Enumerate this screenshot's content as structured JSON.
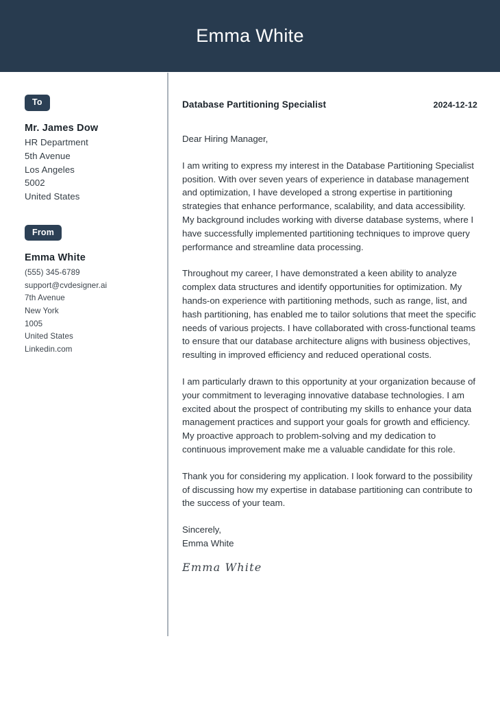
{
  "header": {
    "name": "Emma White"
  },
  "sidebar": {
    "to": {
      "badge_label": "To",
      "name": "Mr. James Dow",
      "lines": [
        "HR Department",
        "5th Avenue",
        "Los Angeles",
        "5002",
        "United States"
      ]
    },
    "from": {
      "badge_label": "From",
      "name": "Emma White",
      "lines": [
        "(555) 345-6789",
        "support@cvdesigner.ai",
        "7th Avenue",
        "New York",
        "1005",
        "United States",
        "Linkedin.com"
      ]
    }
  },
  "letter": {
    "job_title": "Database Partitioning Specialist",
    "date": "2024-12-12",
    "salutation": "Dear Hiring Manager,",
    "paragraphs": [
      "I am writing to express my interest in the Database Partitioning Specialist position. With over seven years of experience in database management and optimization, I have developed a strong expertise in partitioning strategies that enhance performance, scalability, and data accessibility. My background includes working with diverse database systems, where I have successfully implemented partitioning techniques to improve query performance and streamline data processing.",
      "Throughout my career, I have demonstrated a keen ability to analyze complex data structures and identify opportunities for optimization. My hands-on experience with partitioning methods, such as range, list, and hash partitioning, has enabled me to tailor solutions that meet the specific needs of various projects. I have collaborated with cross-functional teams to ensure that our database architecture aligns with business objectives, resulting in improved efficiency and reduced operational costs.",
      "I am particularly drawn to this opportunity at your organization because of your commitment to leveraging innovative database technologies. I am excited about the prospect of contributing my skills to enhance your data management practices and support your goals for growth and efficiency. My proactive approach to problem-solving and my dedication to continuous improvement make me a valuable candidate for this role.",
      "Thank you for considering my application. I look forward to the possibility of discussing how my expertise in database partitioning can contribute to the success of your team."
    ],
    "closing_word": "Sincerely,",
    "closing_name": "Emma White",
    "signature": "Emma White"
  },
  "colors": {
    "header_background": "#283b4f",
    "badge_background": "#2c4055",
    "divider": "#aab2ba",
    "text": "#2c343b"
  }
}
